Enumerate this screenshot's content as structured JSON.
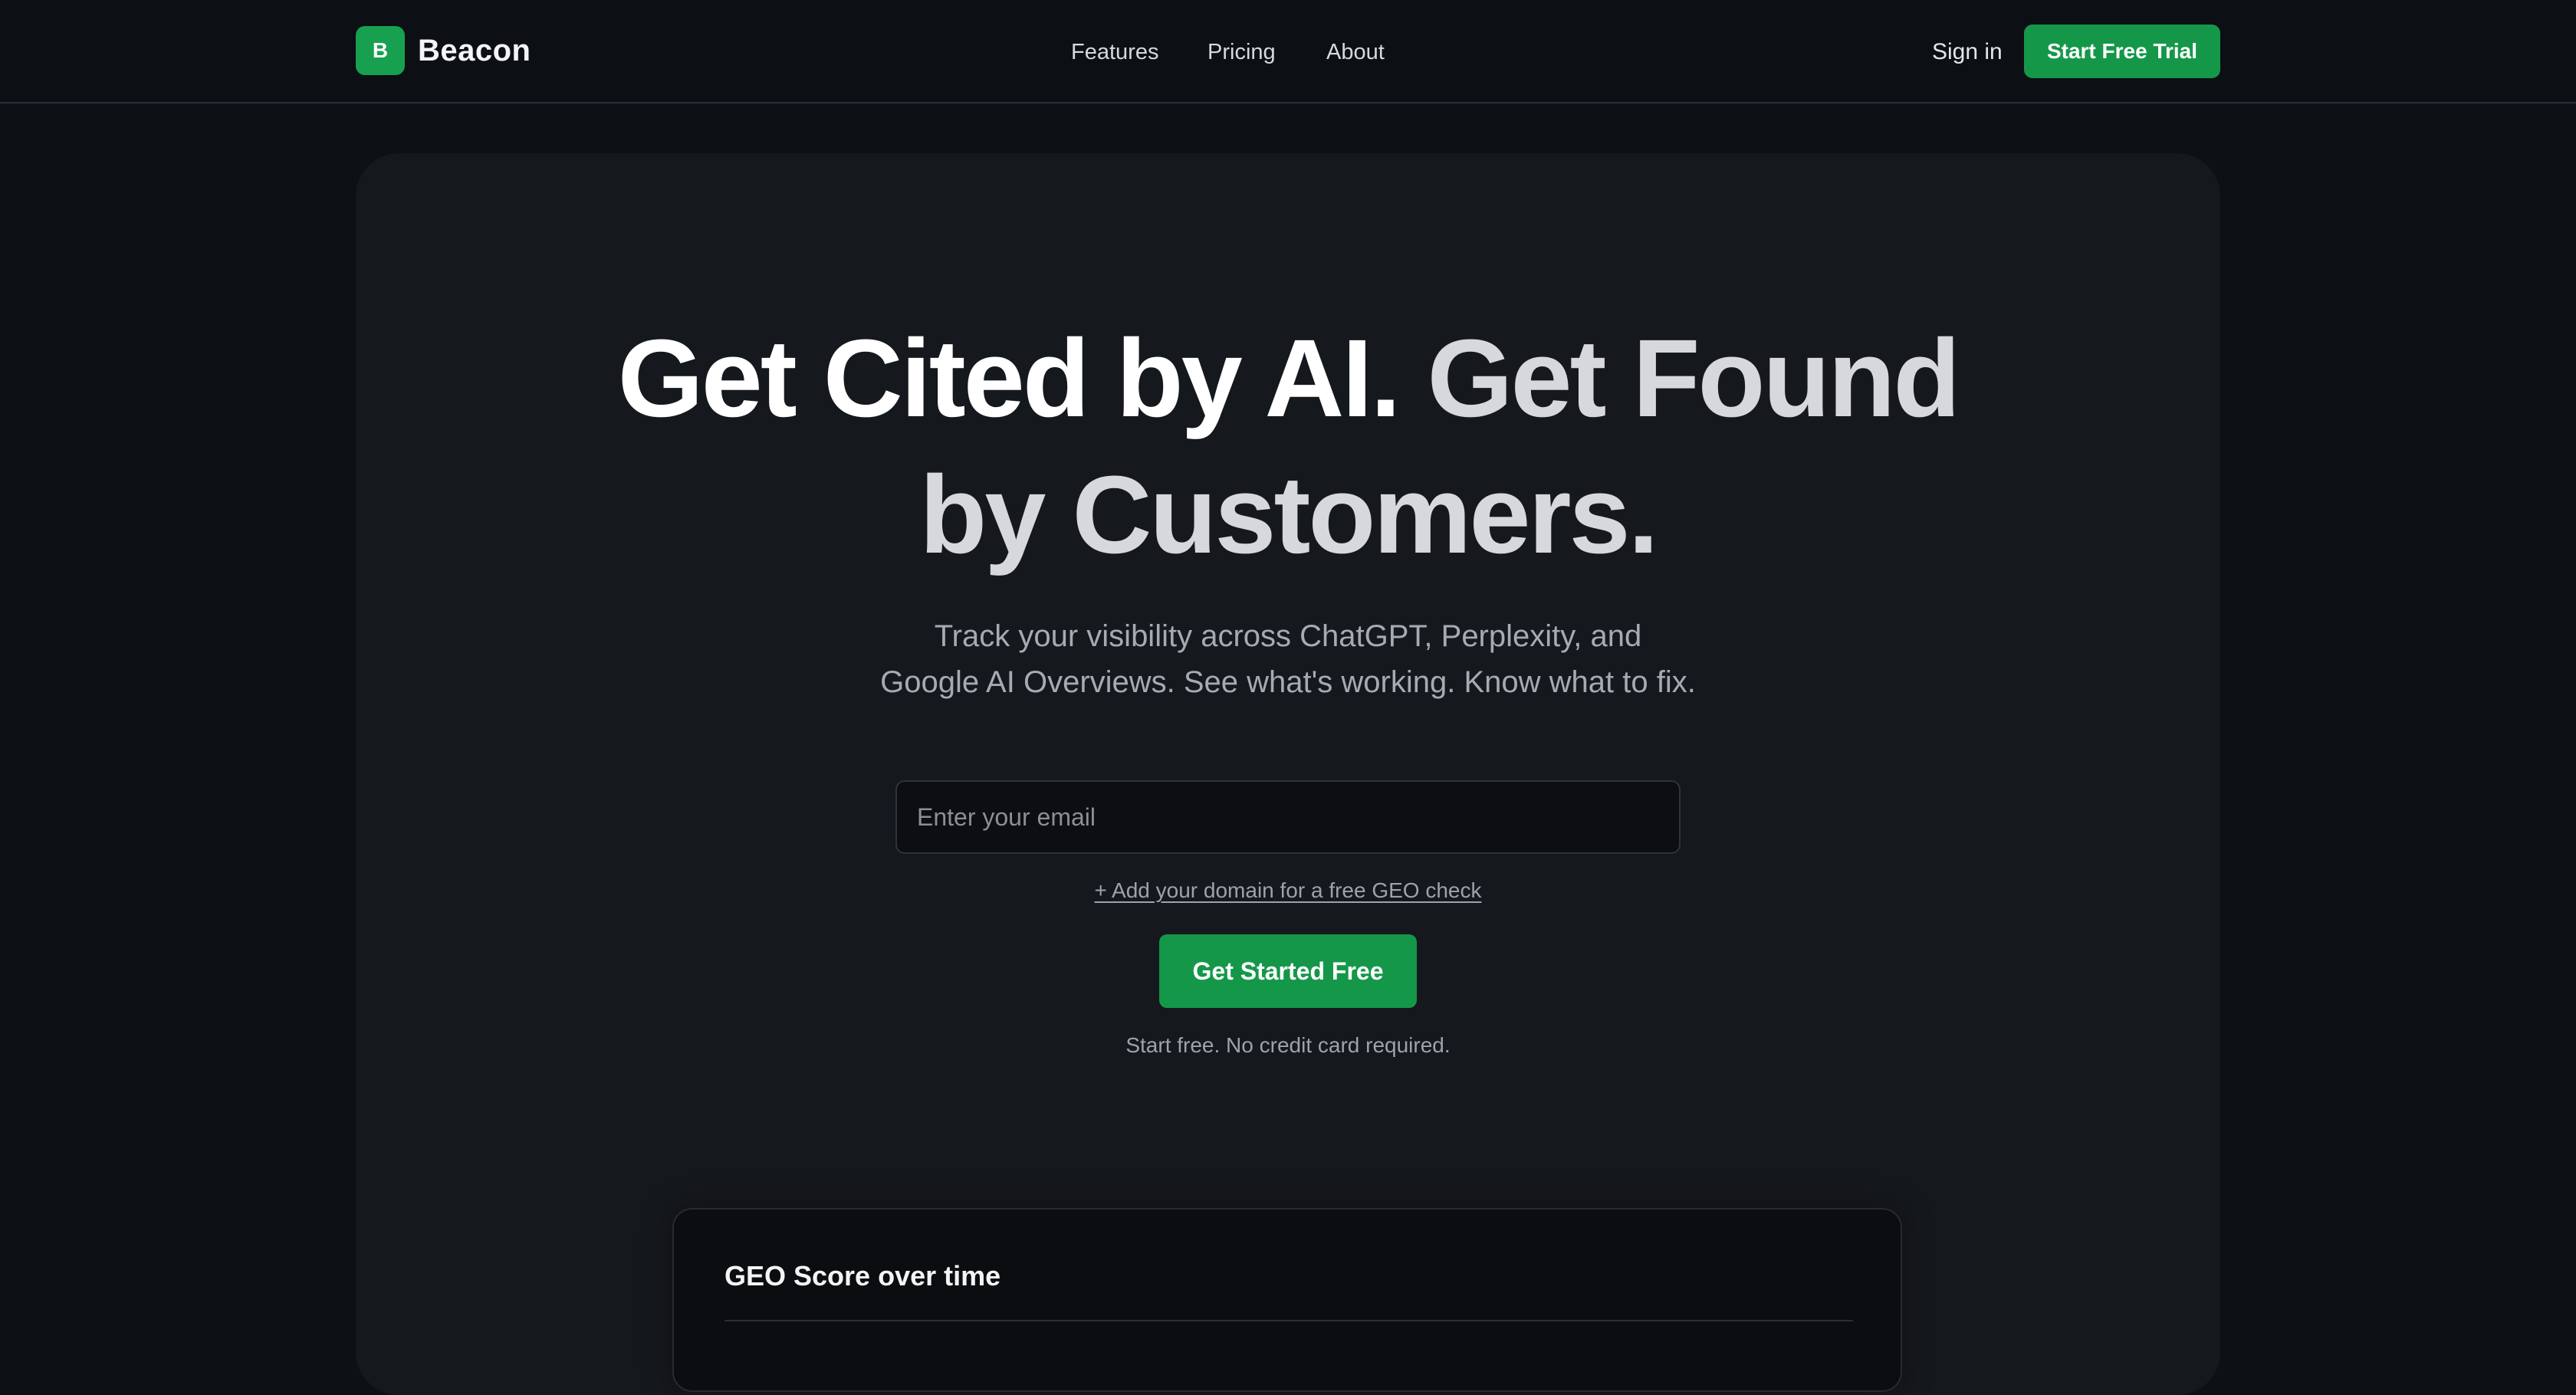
{
  "brand": {
    "mark": "B",
    "name": "Beacon"
  },
  "nav": {
    "items": [
      {
        "label": "Features"
      },
      {
        "label": "Pricing"
      },
      {
        "label": "About"
      }
    ],
    "sign_in": "Sign in",
    "trial_button": "Start Free Trial"
  },
  "hero": {
    "title_primary": "Get Cited by AI.",
    "title_secondary_line1": "Get Found",
    "title_secondary_line2": "by Customers.",
    "subtitle_line1": "Track your visibility across ChatGPT, Perplexity, and",
    "subtitle_line2": "Google AI Overviews. See what's working. Know what to fix.",
    "email_placeholder": "Enter your email",
    "domain_link": "+ Add your domain for a free GEO check",
    "cta": "Get Started Free",
    "fine_print": "Start free. No credit card required."
  },
  "score_card": {
    "title": "GEO Score over time"
  },
  "colors": {
    "accent": "#15974a",
    "background": "#0d1014",
    "card": "#15181d"
  }
}
